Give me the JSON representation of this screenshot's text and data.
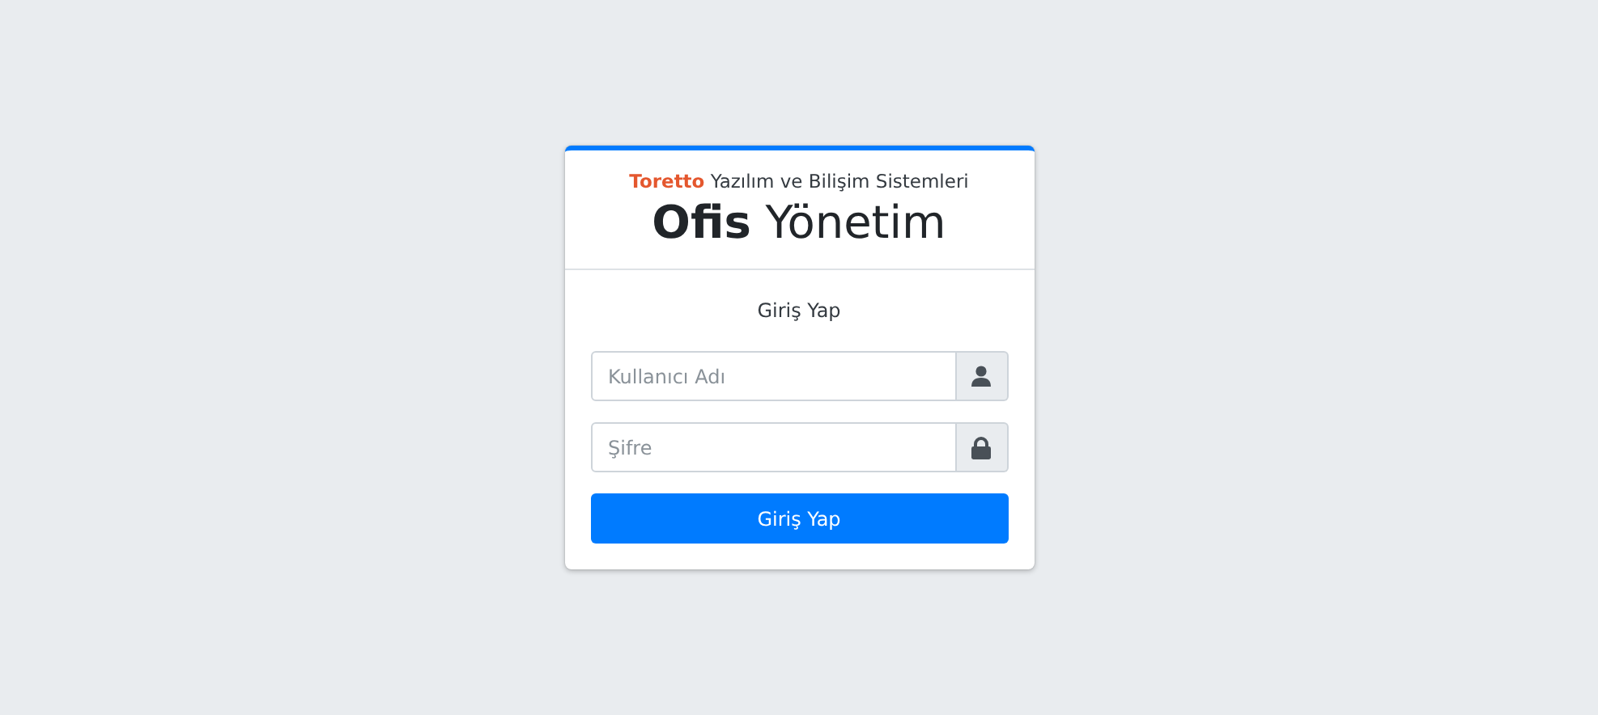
{
  "login_card": {
    "brand_highlight": "Toretto",
    "brand_rest": "Yazılım ve Bilişim Sistemleri",
    "title": "**Ofis** Yönetim",
    "heading": "Giriş Yap",
    "fields": [
      {
        "placeholder": "Kullanıcı Adı",
        "kind": "user"
      },
      {
        "placeholder": "Şifre",
        "kind": "password"
      }
    ],
    "button": "Giriş Yap"
  }
}
